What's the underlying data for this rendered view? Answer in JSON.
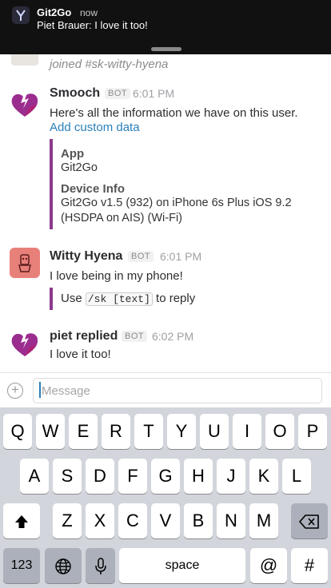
{
  "notification": {
    "app_name": "Git2Go",
    "time": "now",
    "body": "Piet Brauer: I love it too!"
  },
  "joined": "joined #sk-witty-hyena",
  "messages": [
    {
      "sender": "Smooch",
      "badge": "BOT",
      "time": "6:01 PM",
      "text": "Here's all the information we have on this user.",
      "link": "Add custom data",
      "fields": [
        {
          "title": "App",
          "value": "Git2Go"
        },
        {
          "title": "Device Info",
          "value_line1": "Git2Go v1.5 (932) on iPhone 6s Plus iOS 9.2",
          "value_line2": "(HSDPA on AIS) (Wi-Fi)"
        }
      ]
    },
    {
      "sender": "Witty Hyena",
      "badge": "BOT",
      "time": "6:01 PM",
      "text": "I love being in my phone!",
      "hint_prefix": "Use",
      "hint_code": "/sk [text]",
      "hint_suffix": "to reply"
    },
    {
      "sender": "piet replied",
      "badge": "BOT",
      "time": "6:02 PM",
      "text": "I love it too!"
    }
  ],
  "composer": {
    "placeholder": "Message",
    "plus_icon": "plus-circle-icon"
  },
  "keyboard": {
    "row1": [
      "Q",
      "W",
      "E",
      "R",
      "T",
      "Y",
      "U",
      "I",
      "O",
      "P"
    ],
    "row2": [
      "A",
      "S",
      "D",
      "F",
      "G",
      "H",
      "J",
      "K",
      "L"
    ],
    "row3": [
      "Z",
      "X",
      "C",
      "V",
      "B",
      "N",
      "M"
    ],
    "numbers": "123",
    "space": "space",
    "at": "@",
    "hash": "#"
  },
  "colors": {
    "accent_link": "#2a80b9",
    "attachment_bar": "#8b3a8c",
    "smooch_logo": "#9b2d8f"
  }
}
